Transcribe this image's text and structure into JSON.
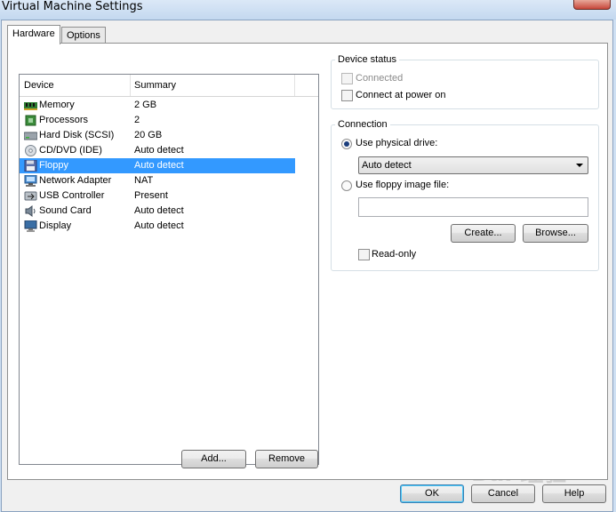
{
  "window": {
    "title": "Virtual Machine Settings"
  },
  "tabs": [
    {
      "label": "Hardware",
      "active": true
    },
    {
      "label": "Options",
      "active": false
    }
  ],
  "device_list": {
    "columns": [
      "Device",
      "Summary"
    ],
    "rows": [
      {
        "icon": "memory-icon",
        "device": "Memory",
        "summary": "2 GB",
        "selected": false
      },
      {
        "icon": "processor-icon",
        "device": "Processors",
        "summary": "2",
        "selected": false
      },
      {
        "icon": "hard-disk-icon",
        "device": "Hard Disk (SCSI)",
        "summary": "20 GB",
        "selected": false
      },
      {
        "icon": "cd-dvd-icon",
        "device": "CD/DVD (IDE)",
        "summary": "Auto detect",
        "selected": false
      },
      {
        "icon": "floppy-icon",
        "device": "Floppy",
        "summary": "Auto detect",
        "selected": true
      },
      {
        "icon": "network-adapter-icon",
        "device": "Network Adapter",
        "summary": "NAT",
        "selected": false
      },
      {
        "icon": "usb-controller-icon",
        "device": "USB Controller",
        "summary": "Present",
        "selected": false
      },
      {
        "icon": "sound-card-icon",
        "device": "Sound Card",
        "summary": "Auto detect",
        "selected": false
      },
      {
        "icon": "display-icon",
        "device": "Display",
        "summary": "Auto detect",
        "selected": false
      }
    ]
  },
  "list_buttons": {
    "add": "Add...",
    "remove": "Remove"
  },
  "device_status": {
    "title": "Device status",
    "connected": {
      "label": "Connected",
      "checked": false,
      "enabled": false
    },
    "connect_at_power_on": {
      "label": "Connect at power on",
      "checked": false
    }
  },
  "connection": {
    "title": "Connection",
    "use_physical_drive": {
      "label": "Use physical drive:",
      "selected": true
    },
    "drive_select_value": "Auto detect",
    "use_floppy_image": {
      "label": "Use floppy image file:",
      "selected": false
    },
    "image_path_value": "",
    "create_button": "Create...",
    "browse_button": "Browse...",
    "read_only": {
      "label": "Read-only",
      "checked": false
    }
  },
  "dialog_buttons": {
    "ok": "OK",
    "cancel": "Cancel",
    "help": "Help"
  },
  "watermark": {
    "text": "Bai 经验"
  },
  "colors": {
    "selection": "#3399ff",
    "highlight_box": "#e00000"
  }
}
